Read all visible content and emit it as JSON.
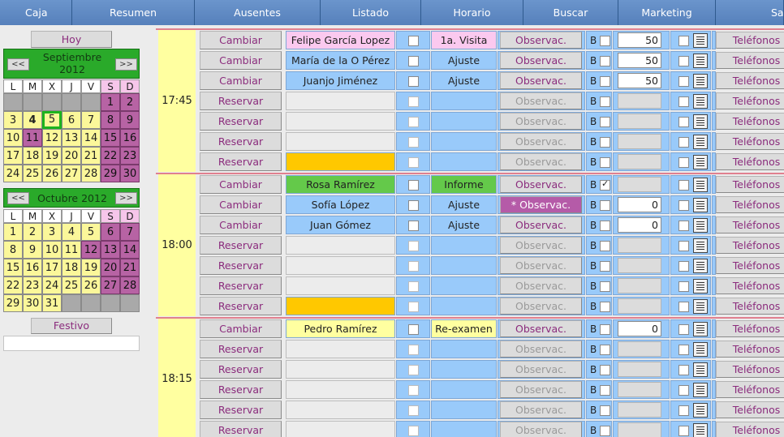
{
  "nav": [
    "Caja",
    "Resumen",
    "Ausentes",
    "Listado",
    "Horario",
    "Buscar",
    "Marketing",
    "Sa"
  ],
  "sidebar": {
    "hoy": "Hoy",
    "festivo": "Festivo",
    "day_headers": [
      "L",
      "M",
      "X",
      "J",
      "V",
      "S",
      "D"
    ],
    "prev": "<<",
    "next": ">>",
    "cal1": {
      "title_line1": "Septiembre",
      "title_line2": "2012",
      "offset": 5,
      "days": 30,
      "today": 4,
      "selected": 5,
      "weekday_highlight": [
        11
      ]
    },
    "cal2": {
      "title_line1": "Octubre 2012",
      "offset": 0,
      "days": 31,
      "weekday_highlight": [
        12
      ]
    }
  },
  "labels": {
    "cambiar": "Cambiar",
    "reservar": "Reservar",
    "observac": "Observac.",
    "observac_star": "* Observac.",
    "b": "B",
    "telefonos": "Teléfonos"
  },
  "colors": {
    "pink": "#fbc9ef",
    "blue": "#99cafa",
    "green": "#64c94a",
    "yellow": "#ffffa0",
    "orange": "#ffc800",
    "empty": "#ececec"
  },
  "slots": [
    {
      "time": "17:45",
      "rows": [
        {
          "action": "cambiar",
          "name": "Felipe García Lopez",
          "name_color": "pink",
          "tipo": "1a. Visita",
          "tipo_color": "pink",
          "obs": "normal",
          "bchk": false,
          "num": "50"
        },
        {
          "action": "cambiar",
          "name": "María de la O Pérez",
          "name_color": "blue",
          "tipo": "Ajuste",
          "tipo_color": "blue",
          "obs": "normal",
          "bchk": false,
          "num": "50"
        },
        {
          "action": "cambiar",
          "name": "Juanjo Jiménez",
          "name_color": "blue",
          "tipo": "Ajuste",
          "tipo_color": "blue",
          "obs": "normal",
          "bchk": false,
          "num": "50"
        },
        {
          "action": "reservar",
          "name": "",
          "name_color": "empty",
          "tipo": "",
          "tipo_color": "blue",
          "obs": "disabled",
          "bchk": false,
          "num": ""
        },
        {
          "action": "reservar",
          "name": "",
          "name_color": "empty",
          "tipo": "",
          "tipo_color": "blue",
          "obs": "disabled",
          "bchk": false,
          "num": ""
        },
        {
          "action": "reservar",
          "name": "",
          "name_color": "empty",
          "tipo": "",
          "tipo_color": "blue",
          "obs": "disabled",
          "bchk": false,
          "num": ""
        },
        {
          "action": "reservar",
          "name": "",
          "name_color": "orange",
          "tipo": "",
          "tipo_color": "blue",
          "obs": "disabled",
          "bchk": false,
          "num": ""
        }
      ]
    },
    {
      "time": "18:00",
      "rows": [
        {
          "action": "cambiar",
          "name": "Rosa Ramírez",
          "name_color": "green",
          "tipo": "Informe",
          "tipo_color": "green",
          "obs": "normal",
          "bchk": true,
          "num": ""
        },
        {
          "action": "cambiar",
          "name": "Sofía López",
          "name_color": "blue",
          "tipo": "Ajuste",
          "tipo_color": "blue",
          "obs": "star",
          "bchk": false,
          "num": "0"
        },
        {
          "action": "cambiar",
          "name": "Juan Gómez",
          "name_color": "blue",
          "tipo": "Ajuste",
          "tipo_color": "blue",
          "obs": "normal",
          "bchk": false,
          "num": "0"
        },
        {
          "action": "reservar",
          "name": "",
          "name_color": "empty",
          "tipo": "",
          "tipo_color": "blue",
          "obs": "disabled",
          "bchk": false,
          "num": ""
        },
        {
          "action": "reservar",
          "name": "",
          "name_color": "empty",
          "tipo": "",
          "tipo_color": "blue",
          "obs": "disabled",
          "bchk": false,
          "num": ""
        },
        {
          "action": "reservar",
          "name": "",
          "name_color": "empty",
          "tipo": "",
          "tipo_color": "blue",
          "obs": "disabled",
          "bchk": false,
          "num": ""
        },
        {
          "action": "reservar",
          "name": "",
          "name_color": "orange",
          "tipo": "",
          "tipo_color": "blue",
          "obs": "disabled",
          "bchk": false,
          "num": ""
        }
      ]
    },
    {
      "time": "18:15",
      "rows": [
        {
          "action": "cambiar",
          "name": "Pedro Ramírez",
          "name_color": "yellow",
          "tipo": "Re-examen",
          "tipo_color": "yellow",
          "obs": "normal",
          "bchk": false,
          "num": "0"
        },
        {
          "action": "reservar",
          "name": "",
          "name_color": "empty",
          "tipo": "",
          "tipo_color": "blue",
          "obs": "disabled",
          "bchk": false,
          "num": ""
        },
        {
          "action": "reservar",
          "name": "",
          "name_color": "empty",
          "tipo": "",
          "tipo_color": "blue",
          "obs": "disabled",
          "bchk": false,
          "num": ""
        },
        {
          "action": "reservar",
          "name": "",
          "name_color": "empty",
          "tipo": "",
          "tipo_color": "blue",
          "obs": "disabled",
          "bchk": false,
          "num": ""
        },
        {
          "action": "reservar",
          "name": "",
          "name_color": "empty",
          "tipo": "",
          "tipo_color": "blue",
          "obs": "disabled",
          "bchk": false,
          "num": ""
        },
        {
          "action": "reservar",
          "name": "",
          "name_color": "empty",
          "tipo": "",
          "tipo_color": "blue",
          "obs": "disabled",
          "bchk": false,
          "num": ""
        }
      ]
    }
  ]
}
